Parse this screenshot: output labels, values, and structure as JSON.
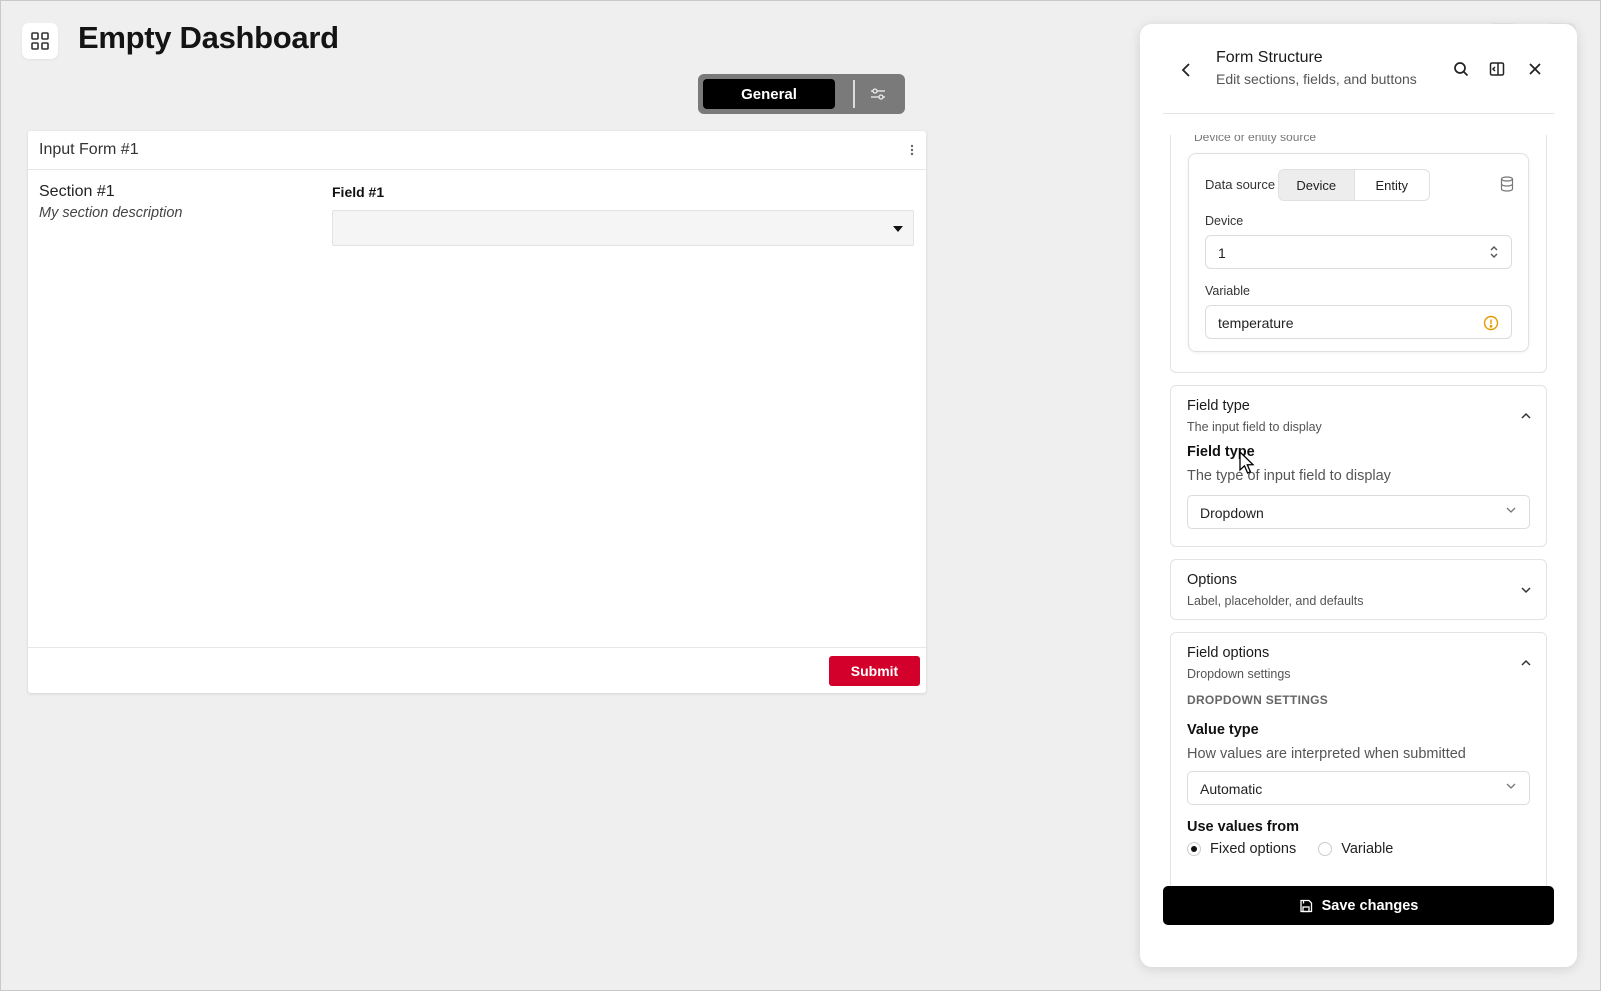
{
  "header": {
    "title": "Empty Dashboard",
    "apps_icon": "grid-icon"
  },
  "mode_toggle": {
    "general_label": "General",
    "settings_icon": "sliders-icon"
  },
  "widget": {
    "title": "Input Form #1",
    "menu_icon": "kebab-icon",
    "section": {
      "title": "Section #1",
      "description": "My section description"
    },
    "field": {
      "label": "Field #1",
      "value": ""
    },
    "submit_label": "Submit",
    "submit_color": "#d3002b"
  },
  "panel": {
    "title": "Form Structure",
    "subtitle": "Edit sections, fields, and buttons",
    "cut_text": "Device or entity source",
    "data_source": {
      "label": "Data source",
      "options": [
        "Device",
        "Entity"
      ],
      "selected": "Device",
      "device_label": "Device",
      "device_value": "1",
      "variable_label": "Variable",
      "variable_value": "temperature",
      "warning_color": "#e69a00"
    },
    "field_type_section": {
      "title": "Field type",
      "subtitle": "The input field to display",
      "heading": "Field type",
      "description": "The type of input field to display",
      "value": "Dropdown"
    },
    "options_section": {
      "title": "Options",
      "subtitle": "Label, placeholder, and defaults"
    },
    "field_options_section": {
      "title": "Field options",
      "subtitle": "Dropdown settings",
      "caps": "DROPDOWN SETTINGS",
      "value_type_heading": "Value type",
      "value_type_desc": "How values are interpreted when submitted",
      "value_type_value": "Automatic",
      "use_values_heading": "Use values from",
      "use_values_options": [
        "Fixed options",
        "Variable"
      ],
      "use_values_selected": "Fixed options"
    },
    "save_label": "Save changes"
  }
}
